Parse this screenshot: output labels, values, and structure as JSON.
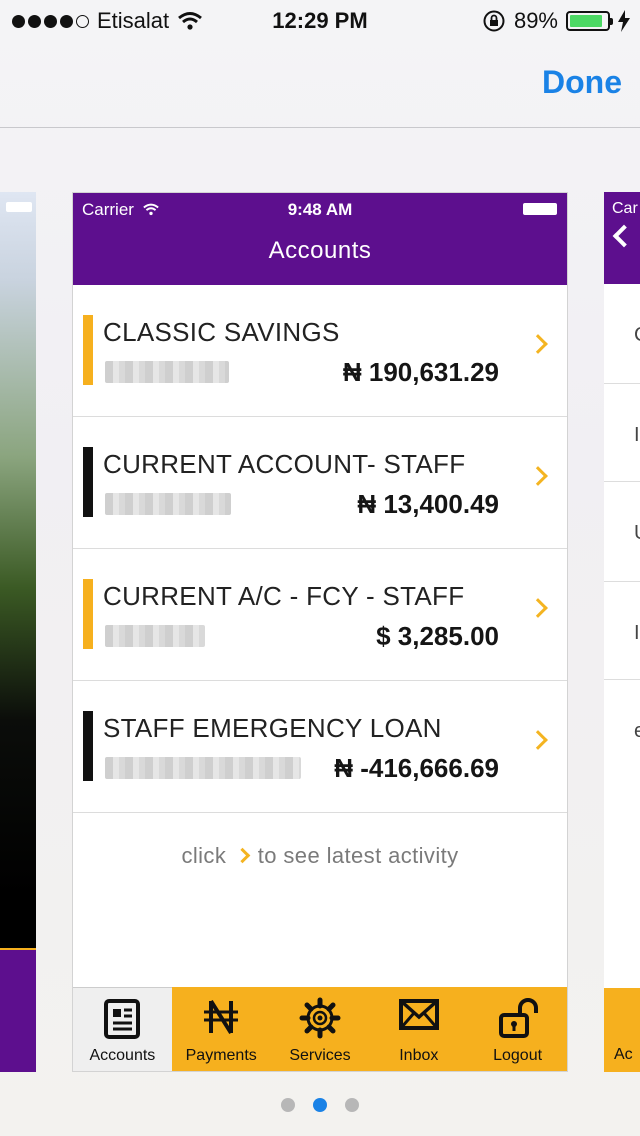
{
  "status_bar": {
    "carrier": "Etisalat",
    "time": "12:29 PM",
    "battery": "89%",
    "battery_level": 0.89,
    "signal_bars": 4
  },
  "header": {
    "done_label": "Done"
  },
  "app": {
    "status": {
      "carrier": "Carrier",
      "time": "9:48 AM"
    },
    "title": "Accounts",
    "accounts": [
      {
        "name": "CLASSIC SAVINGS",
        "balance": "₦ 190,631.29",
        "bar_color": "#f6b01e"
      },
      {
        "name": "CURRENT ACCOUNT- STAFF",
        "balance": "₦ 13,400.49",
        "bar_color": "#111111"
      },
      {
        "name": "CURRENT A/C - FCY - STAFF",
        "balance": "$ 3,285.00",
        "bar_color": "#f6b01e"
      },
      {
        "name": "STAFF EMERGENCY LOAN",
        "balance": "₦ -416,666.69",
        "bar_color": "#111111"
      }
    ],
    "hint": {
      "before": "click",
      "after": "to see latest activity"
    },
    "tabs": [
      {
        "label": "Accounts",
        "icon": "document-icon",
        "active": true
      },
      {
        "label": "Payments",
        "icon": "naira-icon",
        "active": false
      },
      {
        "label": "Services",
        "icon": "gear-icon",
        "active": false
      },
      {
        "label": "Inbox",
        "icon": "envelope-icon",
        "active": false
      },
      {
        "label": "Logout",
        "icon": "unlock-icon",
        "active": false
      }
    ]
  },
  "side_cards": {
    "right": {
      "status_fragment": "Car",
      "row_initials": [
        "C",
        "I",
        "U",
        "I",
        "e"
      ],
      "tab_fragment": "Ac"
    }
  },
  "page_control": {
    "count": 3,
    "current": 2
  },
  "colors": {
    "brand_purple": "#5d0f8e",
    "brand_yellow": "#f6b01e",
    "accent_blue": "#1a82e6",
    "chevron": "#f4b421"
  }
}
